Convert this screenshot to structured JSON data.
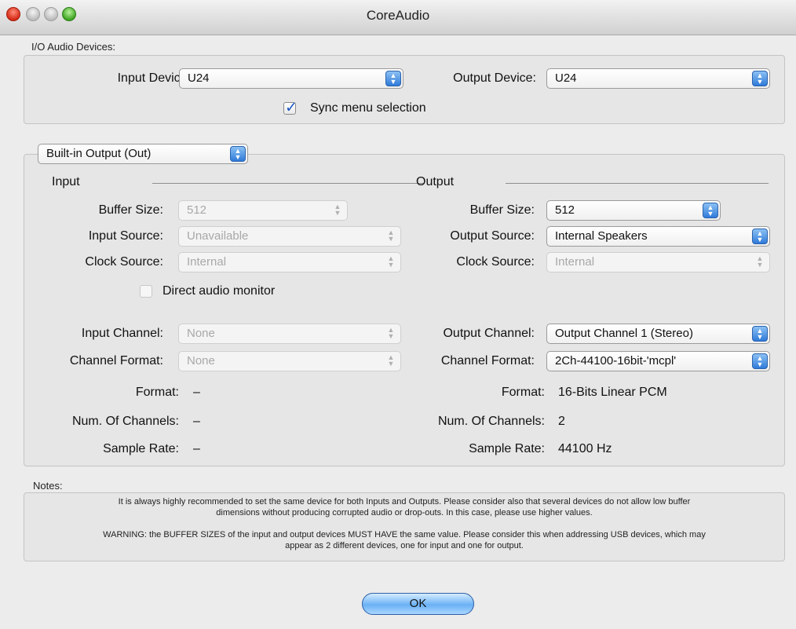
{
  "window": {
    "title": "CoreAudio"
  },
  "io_devices": {
    "section_title": "I/O Audio Devices:",
    "input_device_label": "Input Device:",
    "input_device_value": "U24",
    "output_device_label": "Output Device:",
    "output_device_value": "U24",
    "sync_label": "Sync menu selection",
    "sync_checked": true
  },
  "device_panel": {
    "device_select_value": "Built-in Output (Out)",
    "input": {
      "heading": "Input",
      "buffer_size_label": "Buffer Size:",
      "buffer_size_value": "512",
      "source_label": "Input Source:",
      "source_value": "Unavailable",
      "clock_label": "Clock Source:",
      "clock_value": "Internal",
      "direct_monitor_label": "Direct audio monitor",
      "channel_label": "Input Channel:",
      "channel_value": "None",
      "format_label": "Channel Format:",
      "format_value": "None",
      "info_format_label": "Format:",
      "info_format_value": "–",
      "info_channels_label": "Num. Of Channels:",
      "info_channels_value": "–",
      "info_rate_label": "Sample Rate:",
      "info_rate_value": "–"
    },
    "output": {
      "heading": "Output",
      "buffer_size_label": "Buffer Size:",
      "buffer_size_value": "512",
      "source_label": "Output Source:",
      "source_value": "Internal Speakers",
      "clock_label": "Clock Source:",
      "clock_value": "Internal",
      "channel_label": "Output Channel:",
      "channel_value": "Output Channel 1 (Stereo)",
      "format_label": "Channel Format:",
      "format_value": "2Ch-44100-16bit-'mcpl'",
      "info_format_label": "Format:",
      "info_format_value": "16-Bits Linear PCM",
      "info_channels_label": "Num. Of Channels:",
      "info_channels_value": "2",
      "info_rate_label": "Sample Rate:",
      "info_rate_value": "44100 Hz"
    }
  },
  "notes": {
    "title": "Notes:",
    "line1": "It is always highly recommended to set the same device for both Inputs and Outputs. Please consider also that several devices do not allow low buffer",
    "line2": "dimensions without producing corrupted audio or drop-outs. In this case, please use higher values.",
    "line3": "WARNING: the BUFFER SIZES of the input and output devices MUST HAVE the same value. Please consider this when addressing USB devices, which may",
    "line4": "appear as 2 different devices, one for input and one for output."
  },
  "ok_label": "OK"
}
